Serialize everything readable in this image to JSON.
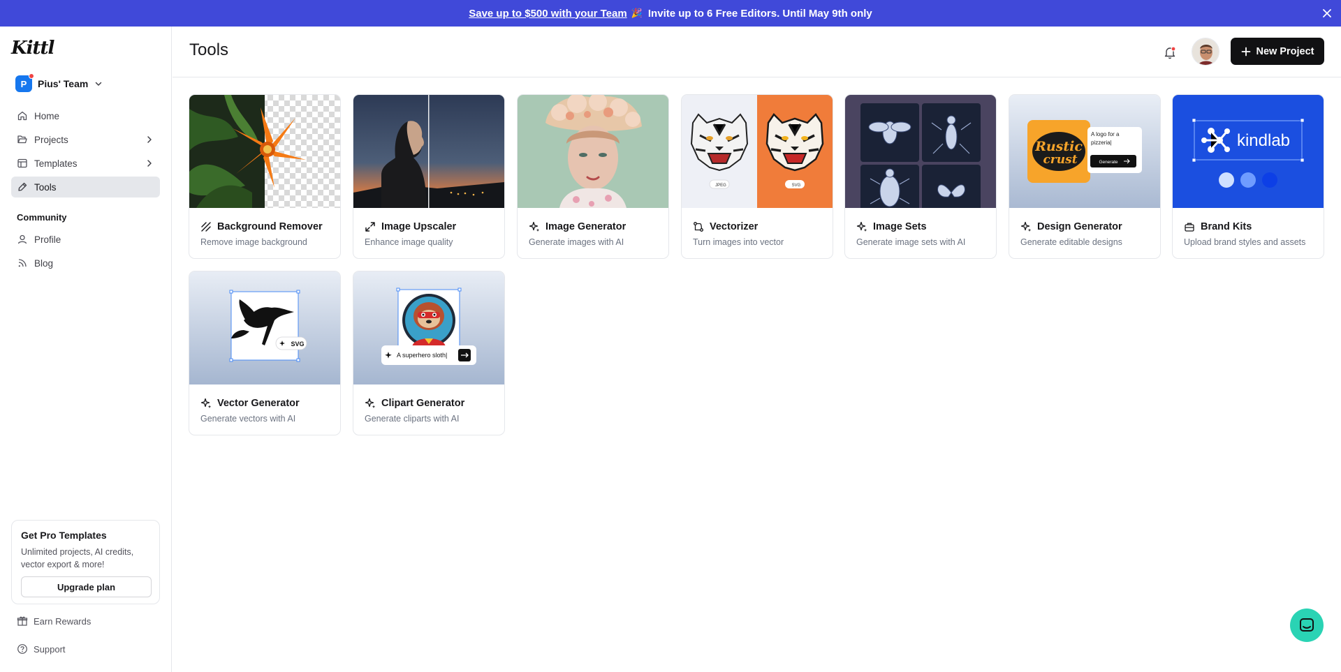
{
  "banner": {
    "link_text": "Save up to $500 with your Team",
    "party_emoji": "🎉",
    "text": "Invite up to 6 Free Editors. Until May 9th only",
    "bg_color": "#4049d9"
  },
  "sidebar": {
    "logo": "Kittl",
    "team": {
      "initial": "P",
      "name": "Pius' Team"
    },
    "nav": [
      {
        "label": "Home",
        "icon": "home-icon"
      },
      {
        "label": "Projects",
        "icon": "folder-icon"
      },
      {
        "label": "Templates",
        "icon": "templates-icon"
      },
      {
        "label": "Tools",
        "icon": "tools-icon",
        "active": true
      }
    ],
    "community_title": "Community",
    "community": [
      {
        "label": "Profile",
        "icon": "user-icon"
      },
      {
        "label": "Blog",
        "icon": "rss-icon"
      }
    ],
    "pro": {
      "title": "Get Pro Templates",
      "text": "Unlimited projects, AI credits, vector export & more!",
      "button": "Upgrade plan"
    },
    "earn_rewards": "Earn Rewards",
    "support": "Support"
  },
  "header": {
    "title": "Tools",
    "new_project": "New Project"
  },
  "tools": [
    {
      "title": "Background Remover",
      "subtitle": "Remove image background",
      "icon": "background-remover-icon"
    },
    {
      "title": "Image Upscaler",
      "subtitle": "Enhance image quality",
      "icon": "expand-icon"
    },
    {
      "title": "Image Generator",
      "subtitle": "Generate images with AI",
      "icon": "sparkle-icon"
    },
    {
      "title": "Vectorizer",
      "subtitle": "Turn images into vector",
      "icon": "vector-icon"
    },
    {
      "title": "Image Sets",
      "subtitle": "Generate image sets with AI",
      "icon": "sparkle-icon"
    },
    {
      "title": "Design Generator",
      "subtitle": "Generate editable designs",
      "icon": "sparkle-icon"
    },
    {
      "title": "Brand Kits",
      "subtitle": "Upload brand styles and assets",
      "icon": "briefcase-icon"
    },
    {
      "title": "Vector Generator",
      "subtitle": "Generate vectors with AI",
      "icon": "sparkle-icon"
    },
    {
      "title": "Clipart Generator",
      "subtitle": "Generate cliparts with AI",
      "icon": "sparkle-icon"
    }
  ],
  "thumbs": {
    "vectorizer": {
      "left_badge": "JPEG",
      "right_badge": "SVG"
    },
    "design_gen": {
      "logo_line1": "Rustic",
      "logo_line2": "crust",
      "prompt": "A logo for a pizzeria|",
      "button": "Generate"
    },
    "brand_kits": {
      "brand": "kindlab"
    },
    "vector_gen": {
      "badge": "SVG"
    },
    "clipart_gen": {
      "prompt": "A superhero sloth|"
    }
  },
  "colors": {
    "accent": "#4049d9",
    "vectorizer_orange": "#f07c3a",
    "brand_blue": "#1b4fe0",
    "chat": "#2ad3b4"
  }
}
